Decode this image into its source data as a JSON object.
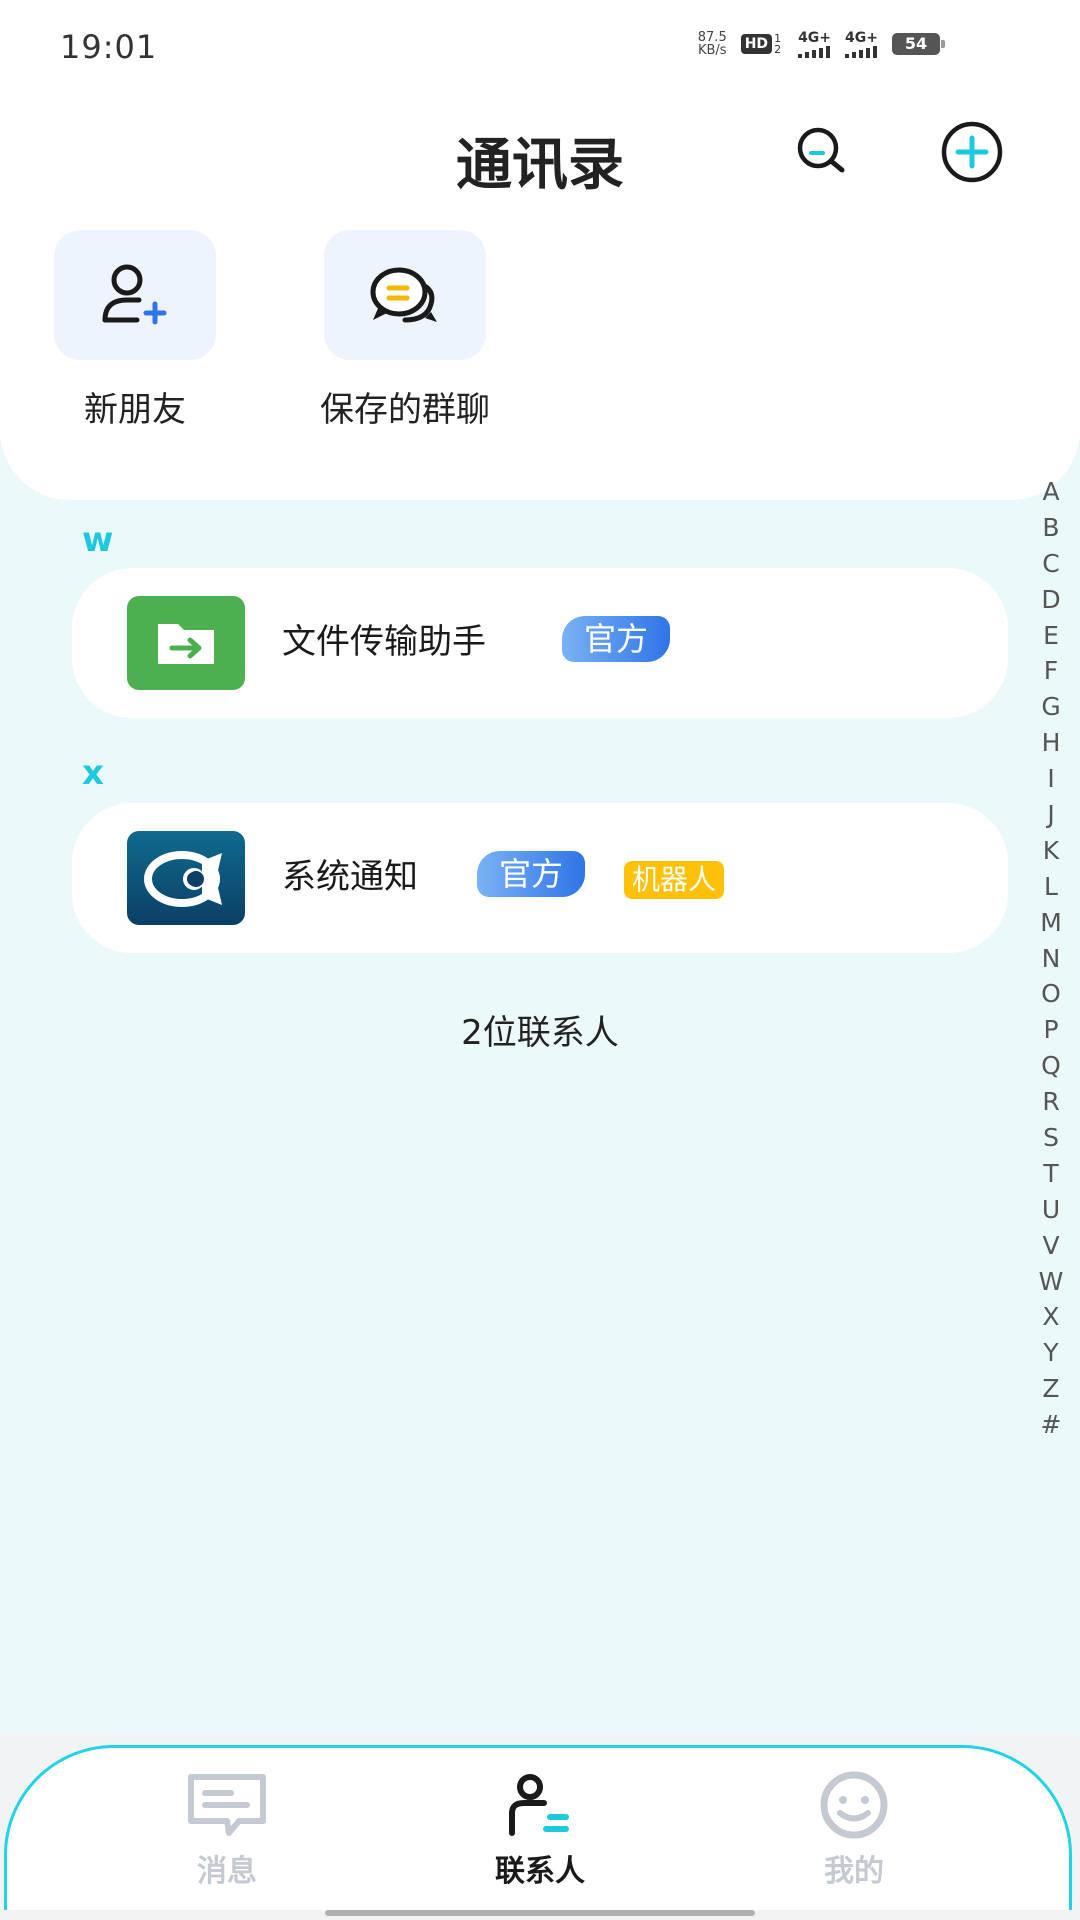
{
  "status_bar": {
    "time": "19:01",
    "net_speed_value": "87.5",
    "net_speed_unit": "KB/s",
    "hd_label": "HD",
    "hd_sub": "1 2",
    "signal_1": "4G+",
    "signal_2": "4G+",
    "battery": "54"
  },
  "header": {
    "title": "通讯录",
    "search_icon": "search-icon",
    "add_icon": "plus-circle-icon"
  },
  "quick_actions": [
    {
      "label": "新朋友",
      "icon": "add-user-icon"
    },
    {
      "label": "保存的群聊",
      "icon": "chat-bubbles-icon"
    }
  ],
  "sections": [
    {
      "letter": "W",
      "contact": {
        "name": "文件传输助手",
        "avatar": "folder-arrow-icon",
        "tags": [
          "官方"
        ]
      }
    },
    {
      "letter": "X",
      "contact": {
        "name": "系统通知",
        "avatar": "system-logo-icon",
        "tags": [
          "官方",
          "机器人"
        ]
      }
    }
  ],
  "contact_count": "2位联系人",
  "index_letters": [
    "A",
    "B",
    "C",
    "D",
    "E",
    "F",
    "G",
    "H",
    "I",
    "J",
    "K",
    "L",
    "M",
    "N",
    "O",
    "P",
    "Q",
    "R",
    "S",
    "T",
    "U",
    "V",
    "W",
    "X",
    "Y",
    "Z",
    "#"
  ],
  "bottom_nav": {
    "items": [
      {
        "label": "消息",
        "icon": "message-icon",
        "active": false
      },
      {
        "label": "联系人",
        "icon": "contacts-icon",
        "active": true
      },
      {
        "label": "我的",
        "icon": "smiley-icon",
        "active": false
      }
    ]
  },
  "colors": {
    "accent": "#1ec9dd",
    "background": "#ecf9fa",
    "official_tag": "#2f74e8",
    "robot_tag": "#ffc107",
    "file_avatar": "#4caf50"
  }
}
